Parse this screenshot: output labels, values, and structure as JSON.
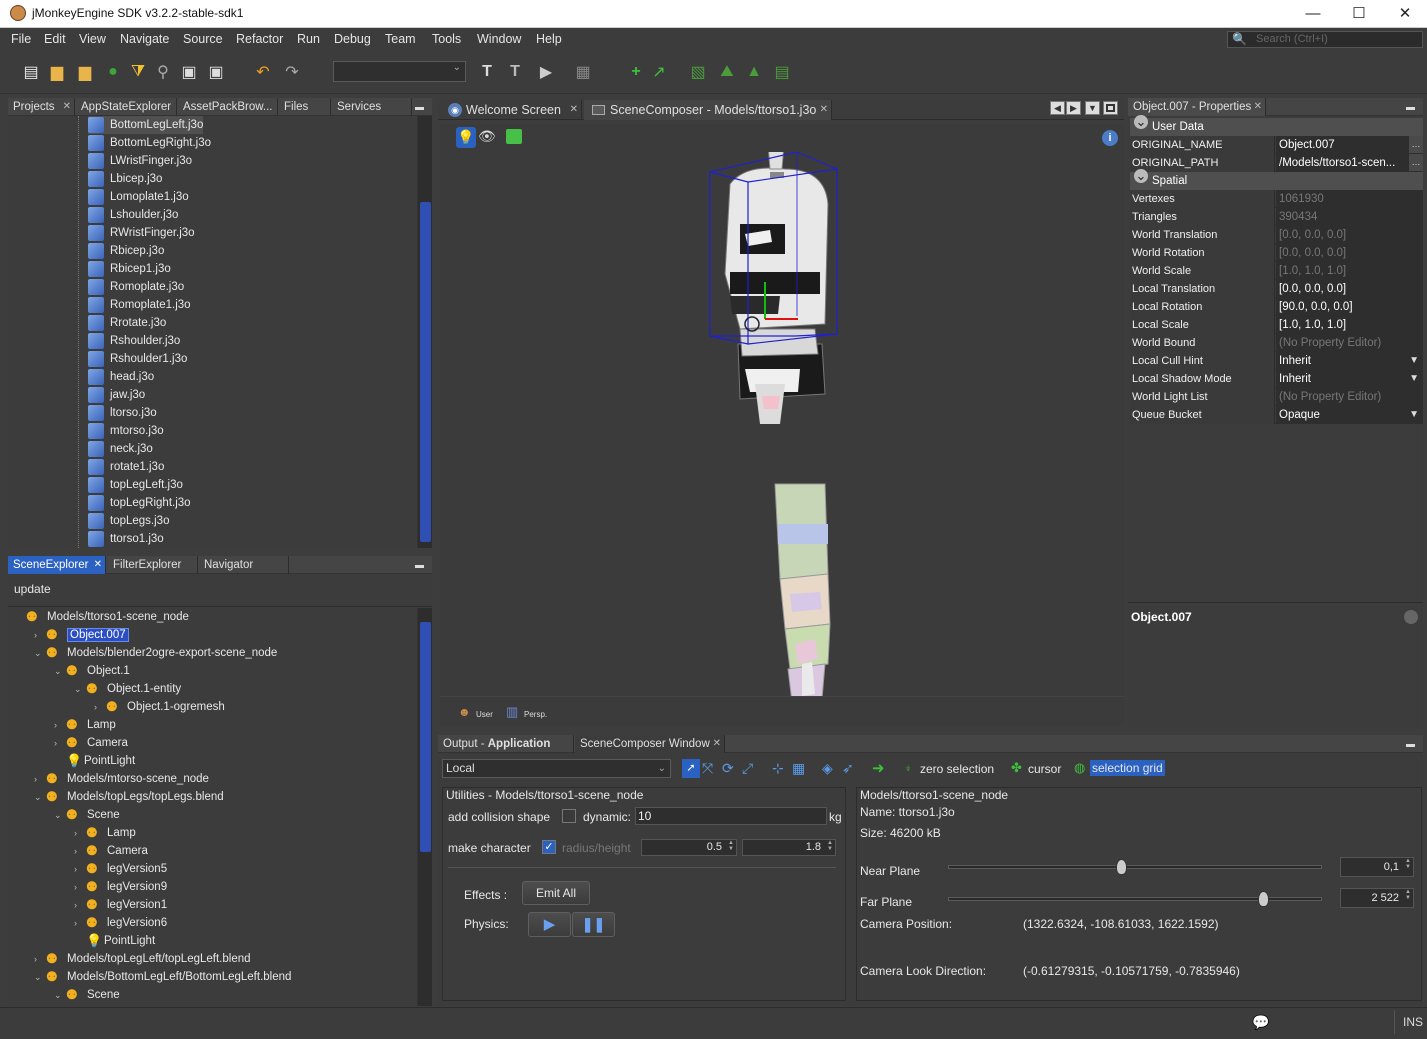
{
  "window": {
    "title": "jMonkeyEngine SDK v3.2.2-stable-sdk1",
    "min": "—",
    "max": "☐",
    "close": "✕"
  },
  "menu": [
    "File",
    "Edit",
    "View",
    "Navigate",
    "Source",
    "Refactor",
    "Run",
    "Debug",
    "Team",
    "Tools",
    "Window",
    "Help"
  ],
  "search": {
    "placeholder": "Search (Ctrl+I)"
  },
  "projects_tabs": [
    "Projects",
    "AppStateExplorer",
    "AssetPackBrow...",
    "Files",
    "Services"
  ],
  "files": [
    "BottomLegLeft.j3o",
    "BottomLegRight.j3o",
    "LWristFinger.j3o",
    "Lbicep.j3o",
    "Lomoplate1.j3o",
    "Lshoulder.j3o",
    "RWristFinger.j3o",
    "Rbicep.j3o",
    "Rbicep1.j3o",
    "Romoplate.j3o",
    "Romoplate1.j3o",
    "Rrotate.j3o",
    "Rshoulder.j3o",
    "Rshoulder1.j3o",
    "head.j3o",
    "jaw.j3o",
    "ltorso.j3o",
    "mtorso.j3o",
    "neck.j3o",
    "rotate1.j3o",
    "topLegLeft.j3o",
    "topLegRight.j3o",
    "topLegs.j3o",
    "ttorso1.j3o"
  ],
  "scene_tabs": [
    "SceneExplorer",
    "FilterExplorer",
    "Navigator"
  ],
  "update_label": "update",
  "scene_tree": [
    {
      "label": "Models/ttorso1-scene_node",
      "depth": 0,
      "icon": "node",
      "tog": ""
    },
    {
      "label": "Object.007",
      "depth": 1,
      "icon": "node",
      "tog": "›",
      "selected": true
    },
    {
      "label": "Models/blender2ogre-export-scene_node",
      "depth": 1,
      "icon": "node",
      "tog": "⌄"
    },
    {
      "label": "Object.1",
      "depth": 2,
      "icon": "node",
      "tog": "⌄"
    },
    {
      "label": "Object.1-entity",
      "depth": 3,
      "icon": "node",
      "tog": "⌄"
    },
    {
      "label": "Object.1-ogremesh",
      "depth": 4,
      "icon": "node",
      "tog": "›"
    },
    {
      "label": "Lamp",
      "depth": 2,
      "icon": "node",
      "tog": "›"
    },
    {
      "label": "Camera",
      "depth": 2,
      "icon": "node",
      "tog": "›"
    },
    {
      "label": "PointLight",
      "depth": 2,
      "icon": "bulb",
      "tog": ""
    },
    {
      "label": "Models/mtorso-scene_node",
      "depth": 1,
      "icon": "node",
      "tog": "›"
    },
    {
      "label": "Models/topLegs/topLegs.blend",
      "depth": 1,
      "icon": "node",
      "tog": "⌄"
    },
    {
      "label": "Scene",
      "depth": 2,
      "icon": "node",
      "tog": "⌄"
    },
    {
      "label": "Lamp",
      "depth": 3,
      "icon": "node",
      "tog": "›"
    },
    {
      "label": "Camera",
      "depth": 3,
      "icon": "node",
      "tog": "›"
    },
    {
      "label": "legVersion5",
      "depth": 3,
      "icon": "node",
      "tog": "›"
    },
    {
      "label": "legVersion9",
      "depth": 3,
      "icon": "node",
      "tog": "›"
    },
    {
      "label": "legVersion1",
      "depth": 3,
      "icon": "node",
      "tog": "›"
    },
    {
      "label": "legVersion6",
      "depth": 3,
      "icon": "node",
      "tog": "›"
    },
    {
      "label": "PointLight",
      "depth": 3,
      "icon": "bulb",
      "tog": ""
    },
    {
      "label": "Models/topLegLeft/topLegLeft.blend",
      "depth": 1,
      "icon": "node",
      "tog": "›"
    },
    {
      "label": "Models/BottomLegLeft/BottomLegLeft.blend",
      "depth": 1,
      "icon": "node",
      "tog": "⌄"
    },
    {
      "label": "Scene",
      "depth": 2,
      "icon": "node",
      "tog": "⌄"
    }
  ],
  "editor_tabs": [
    "Welcome Screen",
    "SceneComposer - Models/ttorso1.j3o"
  ],
  "viewport": {
    "user_label": "User",
    "persp_label": "Persp."
  },
  "props": {
    "tab": "Object.007 - Properties",
    "sections": {
      "user_data": "User Data",
      "spatial": "Spatial"
    },
    "user_rows": [
      {
        "k": "ORIGINAL_NAME",
        "v": "Object.007"
      },
      {
        "k": "ORIGINAL_PATH",
        "v": "/Models/ttorso1-scen..."
      }
    ],
    "spatial_rows": [
      {
        "k": "Vertexes",
        "v": "1061930",
        "ro": true
      },
      {
        "k": "Triangles",
        "v": "390434",
        "ro": true
      },
      {
        "k": "World Translation",
        "v": "[0.0, 0.0, 0.0]",
        "ro": true
      },
      {
        "k": "World Rotation",
        "v": "[0.0, 0.0, 0.0]",
        "ro": true
      },
      {
        "k": "World Scale",
        "v": "[1.0, 1.0, 1.0]",
        "ro": true
      },
      {
        "k": "Local Translation",
        "v": "[0.0, 0.0, 0.0]"
      },
      {
        "k": "Local Rotation",
        "v": "[90.0, 0.0, 0.0]"
      },
      {
        "k": "Local Scale",
        "v": "[1.0, 1.0, 1.0]"
      },
      {
        "k": "World Bound",
        "v": "(No Property Editor)",
        "ro": true
      },
      {
        "k": "Local Cull Hint",
        "v": "Inherit",
        "dd": true
      },
      {
        "k": "Local Shadow Mode",
        "v": "Inherit",
        "dd": true
      },
      {
        "k": "World Light List",
        "v": "(No Property Editor)",
        "ro": true
      },
      {
        "k": "Queue Bucket",
        "v": "Opaque",
        "dd": true
      }
    ],
    "desc_title": "Object.007"
  },
  "bottom": {
    "tab_output": "Output - ",
    "tab_output_bold": "Application",
    "tab_composer": "SceneComposer Window",
    "mode": "Local",
    "zero_selection": "zero selection",
    "cursor": "cursor",
    "selection_grid": "selection grid",
    "utilities_title": "Utilities - Models/ttorso1-scene_node",
    "add_collision": "add collision shape",
    "dynamic": "dynamic:",
    "dynamic_value": "10",
    "kg": "kg",
    "make_character": "make character",
    "radius_height": "radius/height",
    "radius": "0.5",
    "height": "1.8",
    "effects": "Effects :",
    "emit_all": "Emit All",
    "physics": "Physics:",
    "info_title": "Models/ttorso1-scene_node",
    "name": "Name: ttorso1.j3o",
    "size": "Size: 46200 kB",
    "near_plane": "Near Plane",
    "near_value": "0,1",
    "near_fraction": 0.46,
    "far_plane": "Far Plane",
    "far_value": "2 522",
    "far_fraction": 0.84,
    "cam_pos_label": "Camera Position:",
    "cam_pos": "(1322.6324, -108.61033, 1622.1592)",
    "cam_look_label": "Camera Look Direction:",
    "cam_look": "(-0.61279315, -0.10571759, -0.7835946)"
  },
  "status": {
    "ins": "INS"
  }
}
